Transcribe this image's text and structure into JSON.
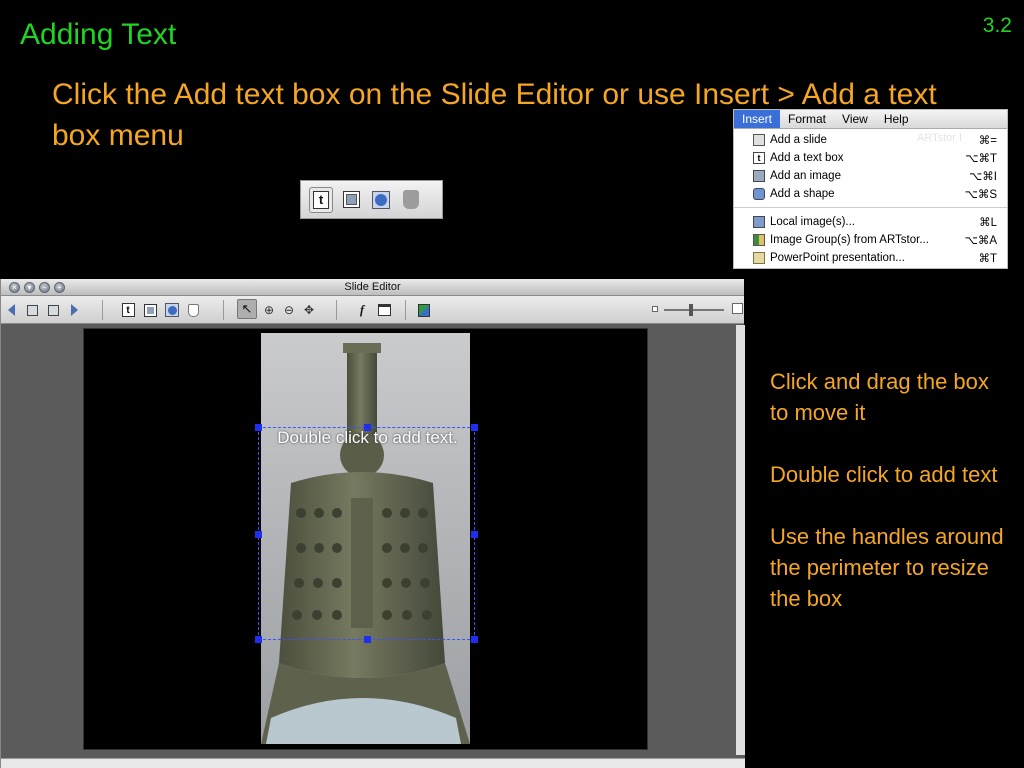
{
  "slide": {
    "title": "Adding Text",
    "number": "3.2",
    "instruction": "Click the Add text box on the Slide Editor or use Insert > Add a text box menu"
  },
  "mini_toolbar": {
    "icons": [
      "text-box-icon",
      "image-icon",
      "shape-icon",
      "bell-icon"
    ],
    "text_glyph": "t"
  },
  "insert_menu": {
    "menubar": [
      "Insert",
      "Format",
      "View",
      "Help"
    ],
    "active": "Insert",
    "ghost_text": "ARTstor I",
    "items_top": [
      {
        "label": "Add a slide",
        "shortcut": "⌘=",
        "icon": "slide-icon"
      },
      {
        "label": "Add a text box",
        "shortcut": "⌥⌘T",
        "icon": "text-box-icon"
      },
      {
        "label": "Add an image",
        "shortcut": "⌥⌘I",
        "icon": "image-icon"
      },
      {
        "label": "Add a shape",
        "shortcut": "⌥⌘S",
        "icon": "shape-icon"
      }
    ],
    "items_bottom": [
      {
        "label": "Local image(s)...",
        "shortcut": "⌘L",
        "icon": "local-image-icon"
      },
      {
        "label": "Image Group(s) from ARTstor...",
        "shortcut": "⌥⌘A",
        "icon": "image-group-icon"
      },
      {
        "label": "PowerPoint presentation...",
        "shortcut": "⌘T",
        "icon": "powerpoint-icon"
      }
    ]
  },
  "editor": {
    "window_title": "Slide Editor",
    "traffic_lights": [
      "×",
      "▾",
      "–",
      "+"
    ],
    "text_glyph": "t",
    "pointer_glyph": "↖",
    "zoom_in_glyph": "⊕",
    "zoom_out_glyph": "⊖",
    "pan_glyph": "✥",
    "fx_glyph": "f",
    "placeholder_text": "Double click to add text."
  },
  "notes": [
    "Click and drag the box to move it",
    "Double click to add text",
    "Use the handles around the perimeter to resize the box"
  ],
  "colors": {
    "title_green": "#22d422",
    "body_orange": "#f5a623",
    "menu_highlight": "#3a6fd8",
    "handle_blue": "#1e2ff0"
  }
}
